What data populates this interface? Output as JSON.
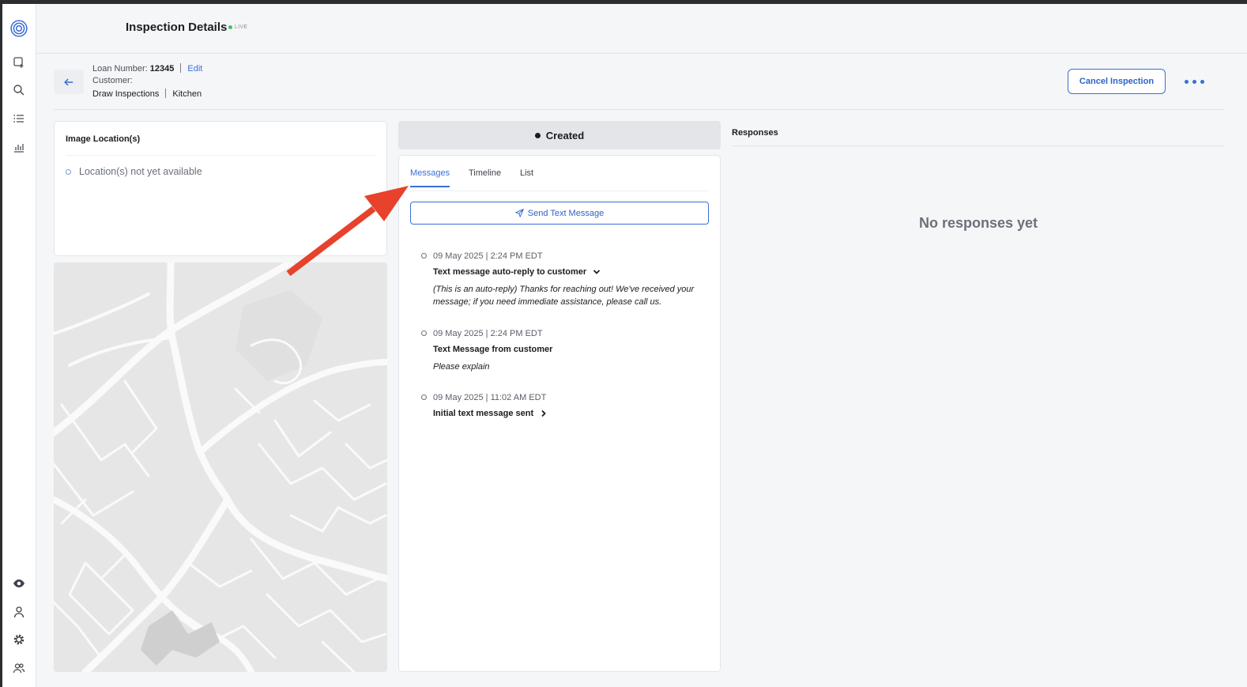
{
  "header": {
    "title": "Inspection Details",
    "live_badge": "LIVE"
  },
  "sidebar": {
    "top_items": [
      "logo-icon",
      "new-inspection-icon",
      "search-icon",
      "list-icon",
      "chart-icon"
    ],
    "bottom_items": [
      "eye-icon",
      "user-icon",
      "gear-icon",
      "users-icon"
    ]
  },
  "subheader": {
    "loan_label": "Loan Number:",
    "loan_number": "12345",
    "edit_label": "Edit",
    "customer_label": "Customer:",
    "breadcrumb_1": "Draw Inspections",
    "breadcrumb_2": "Kitchen",
    "cancel_label": "Cancel Inspection"
  },
  "location_card": {
    "title": "Image Location(s)",
    "empty_text": "Location(s) not yet available"
  },
  "status": {
    "label": "Created"
  },
  "messages": {
    "tabs": [
      "Messages",
      "Timeline",
      "List"
    ],
    "active_tab": "Messages",
    "send_label": "Send Text Message",
    "items": [
      {
        "time": "09 May 2025 | 2:24 PM EDT",
        "title": "Text message auto-reply to customer",
        "body": "(This is an auto-reply) Thanks for reaching out! We've received your message; if you need immediate assistance, please call us."
      },
      {
        "time": "09 May 2025 | 2:24 PM EDT",
        "title": "Text Message from customer",
        "body": "Please explain"
      },
      {
        "time": "09 May 2025 | 11:02 AM EDT",
        "title": "Initial text message sent",
        "body": ""
      }
    ]
  },
  "responses": {
    "title": "Responses",
    "empty_text": "No responses yet"
  },
  "colors": {
    "accent": "#3b6fd4",
    "live": "#3fbf6a",
    "annotation_arrow": "#e8412c"
  }
}
